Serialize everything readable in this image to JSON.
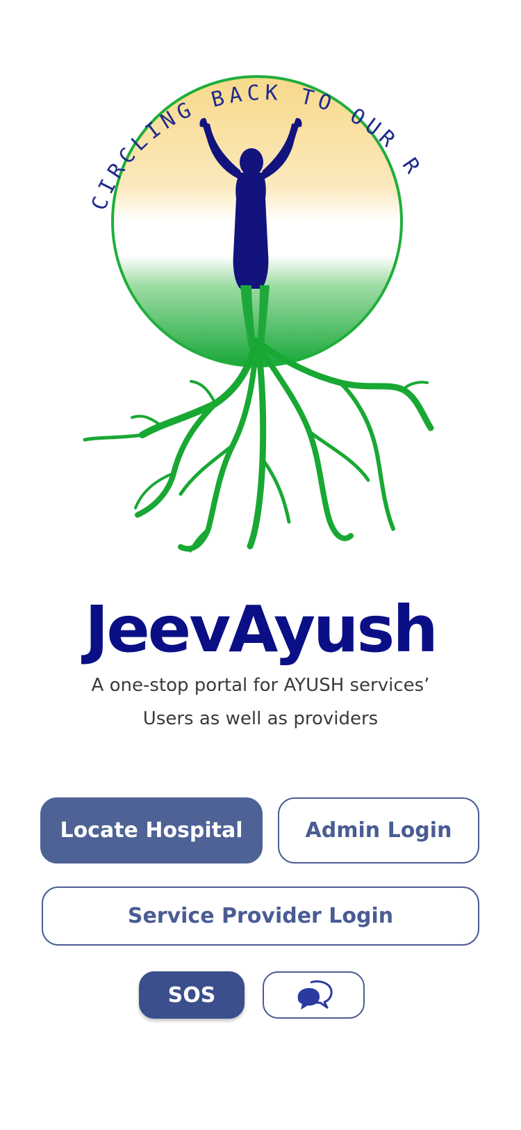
{
  "logo": {
    "arc_text": "CIRCLING BACK TO OUR ROOTS",
    "colors": {
      "saffron": "#f7d98c",
      "white": "#ffffff",
      "green": "#1aa83a",
      "figure": "#13137e",
      "arc_text": "#1e2a8c"
    }
  },
  "brand": {
    "title": "JeevAyush",
    "tagline_line1": "A one-stop portal for AYUSH services’",
    "tagline_line2": "Users as well as providers",
    "title_color": "#0b0f86"
  },
  "actions": {
    "locate_hospital": "Locate Hospital",
    "admin_login": "Admin Login",
    "service_provider_login": "Service Provider Login",
    "sos": "SOS",
    "chat_icon": "chat-bubbles-icon"
  },
  "colors": {
    "primary_button": "#4f6295",
    "outline": "#4a5c93",
    "sos_button": "#3b4f8c"
  }
}
